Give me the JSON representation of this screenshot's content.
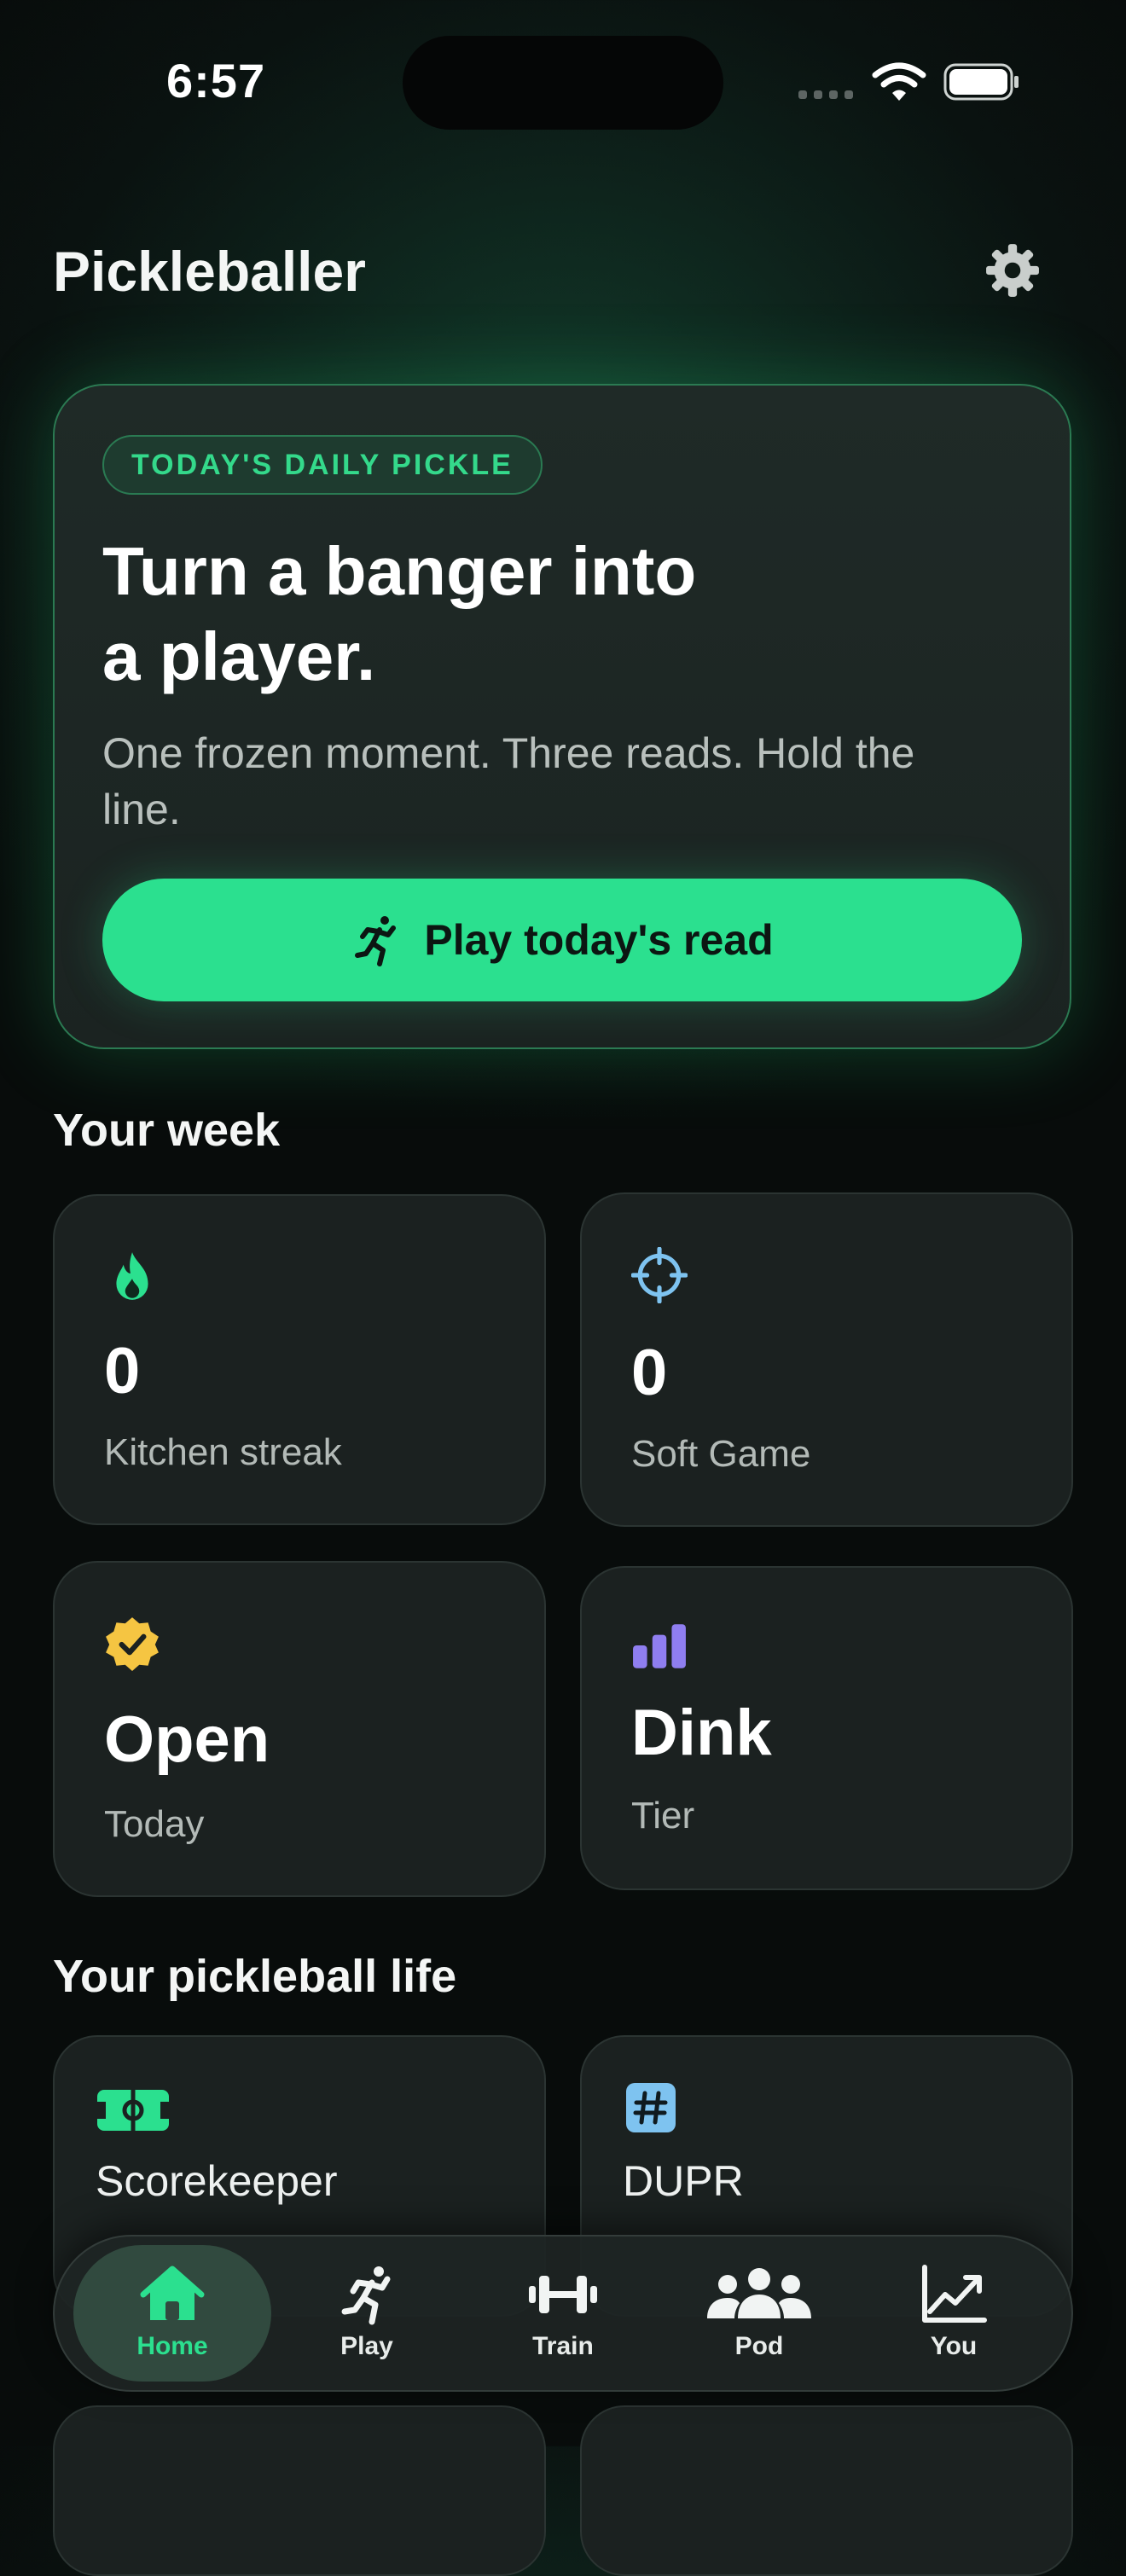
{
  "status_bar": {
    "time": "6:57"
  },
  "header": {
    "title": "Pickleballer",
    "settings_icon": "gear-icon"
  },
  "hero": {
    "badge": "TODAY'S DAILY PICKLE",
    "title_line1": "Turn a banger into",
    "title_line2": "a player.",
    "subtitle": "One frozen moment. Three reads. Hold the line.",
    "cta_label": "Play today's read",
    "cta_icon": "runner-icon"
  },
  "week": {
    "title": "Your week",
    "stats": [
      {
        "value": "0",
        "label": "Kitchen streak",
        "icon": "flame-icon",
        "color": "#2be08f"
      },
      {
        "value": "0",
        "label": "Soft Game",
        "icon": "crosshair-icon",
        "color": "#7ec3f0"
      },
      {
        "value": "Open",
        "label": "Today",
        "icon": "verified-badge-icon",
        "color": "#f5c542"
      },
      {
        "value": "Dink",
        "label": "Tier",
        "icon": "bars-icon",
        "color": "#8f7ef0"
      }
    ]
  },
  "life": {
    "title": "Your pickleball life",
    "cards": [
      {
        "label": "Scorekeeper",
        "icon": "court-icon",
        "color": "#2be08f"
      },
      {
        "label": "DUPR",
        "icon": "hashtag-icon",
        "color": "#7ec3f0"
      }
    ]
  },
  "tabs": [
    {
      "label": "Home",
      "icon": "home-icon",
      "active": true
    },
    {
      "label": "Play",
      "icon": "runner-icon",
      "active": false
    },
    {
      "label": "Train",
      "icon": "dumbbell-icon",
      "active": false
    },
    {
      "label": "Pod",
      "icon": "group-icon",
      "active": false
    },
    {
      "label": "You",
      "icon": "chart-icon",
      "active": false
    }
  ],
  "colors": {
    "accent": "#2be08f",
    "background": "#0a1210",
    "card": "#1b2120"
  }
}
